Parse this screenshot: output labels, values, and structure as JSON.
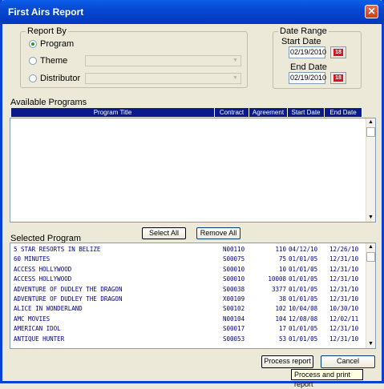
{
  "window": {
    "title": "First Airs Report",
    "close_glyph": "✕"
  },
  "report_by": {
    "legend": "Report By",
    "options": [
      {
        "label": "Program",
        "checked": true
      },
      {
        "label": "Theme",
        "checked": false
      },
      {
        "label": "Distributor",
        "checked": false
      }
    ],
    "combo_arrow": "▼"
  },
  "date_range": {
    "legend": "Date Range",
    "start_label": "Start Date",
    "start_value": "02/19/2010",
    "end_label": "End Date",
    "end_value": "02/19/2010",
    "cal_glyph": "18"
  },
  "available": {
    "label": "Available Programs",
    "columns": [
      "Program Title",
      "Contract",
      "Agreement",
      "Start Date",
      "End Date"
    ],
    "scroll_up": "▲",
    "scroll_down": "▼"
  },
  "buttons": {
    "select_all": "Select All",
    "remove_all": "Remove All",
    "process_report": "Process report",
    "cancel": "Cancel"
  },
  "selected": {
    "label": "Selected Program",
    "rows": [
      {
        "title": "5 STAR RESORTS IN BELIZE",
        "contract": "N00110",
        "agreement": "110",
        "start": "04/12/10",
        "end": "12/26/10"
      },
      {
        "title": "60 MINUTES",
        "contract": "S00075",
        "agreement": "75",
        "start": "01/01/05",
        "end": "12/31/10"
      },
      {
        "title": "ACCESS HOLLYWOOD",
        "contract": "S00010",
        "agreement": "10",
        "start": "01/01/05",
        "end": "12/31/10"
      },
      {
        "title": "ACCESS HOLLYWOOD",
        "contract": "S00010",
        "agreement": "10008",
        "start": "01/01/05",
        "end": "12/31/10"
      },
      {
        "title": "ADVENTURE OF DUDLEY THE DRAGON",
        "contract": "S00038",
        "agreement": "3377",
        "start": "01/01/05",
        "end": "12/31/10"
      },
      {
        "title": "ADVENTURE OF DUDLEY THE DRAGON",
        "contract": "X00109",
        "agreement": "38",
        "start": "01/01/05",
        "end": "12/31/10"
      },
      {
        "title": "ALICE IN WONDERLAND",
        "contract": "S00102",
        "agreement": "102",
        "start": "10/04/08",
        "end": "10/30/10"
      },
      {
        "title": "AMC MOVIES",
        "contract": "N00104",
        "agreement": "104",
        "start": "12/08/08",
        "end": "12/02/11"
      },
      {
        "title": "AMERICAN IDOL",
        "contract": "S00017",
        "agreement": "17",
        "start": "01/01/05",
        "end": "12/31/10"
      },
      {
        "title": "ANTIQUE HUNTER",
        "contract": "S00053",
        "agreement": "53",
        "start": "01/01/05",
        "end": "12/31/10"
      }
    ],
    "scroll_up": "▲",
    "scroll_down": "▼"
  },
  "tooltip": "Process and print report"
}
